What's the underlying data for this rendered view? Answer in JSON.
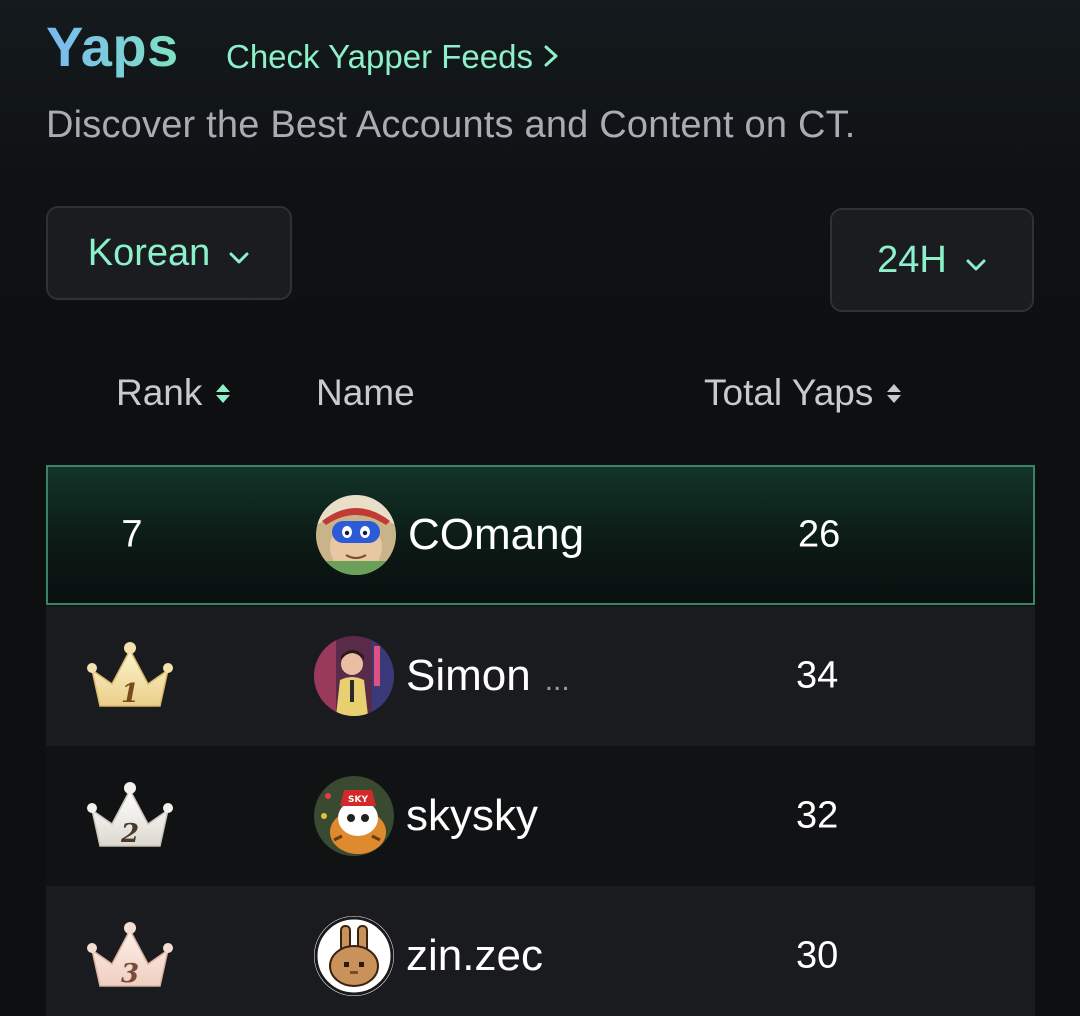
{
  "header": {
    "title": "Yaps",
    "feeds_link": "Check Yapper Feeds",
    "subtitle": "Discover the Best Accounts and Content on CT."
  },
  "filters": {
    "language": "Korean",
    "timeframe": "24H"
  },
  "table": {
    "columns": [
      "Rank",
      "Name",
      "Total Yaps"
    ],
    "rows": [
      {
        "rank": "7",
        "name": "COmang",
        "yaps": "26",
        "highlighted": true
      },
      {
        "rank": "1",
        "name": "Simon",
        "name_suffix": "...",
        "yaps": "34",
        "crown": "gold"
      },
      {
        "rank": "2",
        "name": "skysky",
        "yaps": "32",
        "crown": "silver"
      },
      {
        "rank": "3",
        "name": "zin.zec",
        "yaps": "30",
        "crown": "bronze"
      }
    ]
  },
  "colors": {
    "accent": "#8cf0c8",
    "title_gradient_start": "#79b8f0",
    "background": "#0e0f11",
    "row_background": "#1a1b1e",
    "highlight_border": "#3a8466"
  },
  "icons": {
    "feeds_link": "chevron-right-icon",
    "dropdown": "chevron-down-icon",
    "sort": "sort-icon",
    "rank_badge": "crown-icon"
  }
}
